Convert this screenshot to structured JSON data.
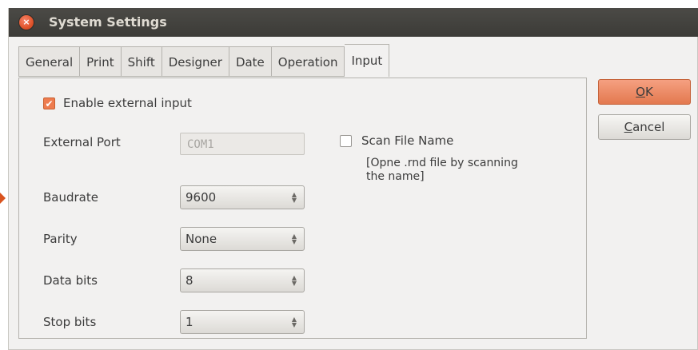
{
  "window": {
    "title": "System Settings",
    "close_glyph": "×"
  },
  "tabs": [
    {
      "label": "General"
    },
    {
      "label": "Print"
    },
    {
      "label": "Shift"
    },
    {
      "label": "Designer"
    },
    {
      "label": "Date"
    },
    {
      "label": "Operation"
    },
    {
      "label": "Input",
      "active": true
    }
  ],
  "input_tab": {
    "enable_external_input": {
      "label": "Enable external input",
      "checked": true
    },
    "external_port": {
      "label": "External Port",
      "value": "COM1",
      "disabled": true
    },
    "baudrate": {
      "label": "Baudrate",
      "value": "9600"
    },
    "parity": {
      "label": "Parity",
      "value": "None"
    },
    "data_bits": {
      "label": "Data bits",
      "value": "8"
    },
    "stop_bits": {
      "label": "Stop bits",
      "value": "1"
    },
    "scan_file_name": {
      "label": "Scan File Name",
      "checked": false
    },
    "scan_description": "[Opne .rnd file by scanning the name]"
  },
  "buttons": {
    "ok_mnemonic": "O",
    "ok_rest": "K",
    "cancel_mnemonic": "C",
    "cancel_rest": "ancel"
  },
  "colors": {
    "accent": "#ee7c4f",
    "titlebar": "#3c3b37",
    "close_button": "#e0542b"
  },
  "icons": {
    "close": "close-icon",
    "checkmark": "checkmark-icon",
    "spinner": "chevron-up-down-icon"
  }
}
